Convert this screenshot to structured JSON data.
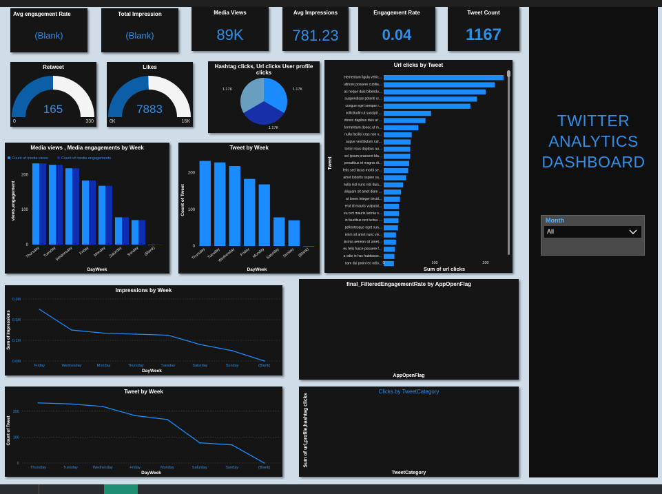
{
  "colors": {
    "accent": "#2f8fe8",
    "bar": "#1a8cff",
    "bar_dark": "#0f2db0",
    "gauge_fill": "#0c5fa6",
    "gauge_rest": "#f4f4f4",
    "card": "#151515",
    "page": "#cfdde9"
  },
  "kpis": [
    {
      "title": "Avg engagement Rate",
      "value": "(Blank)"
    },
    {
      "title": "Total Impression",
      "value": "(Blank)"
    },
    {
      "title": "Media Views",
      "value": "89K"
    },
    {
      "title": "Avg Impressions",
      "value": "781.23"
    },
    {
      "title": "Engagement Rate",
      "value": "0.04"
    },
    {
      "title": "Tweet Count",
      "value": "1167"
    }
  ],
  "gauges": [
    {
      "title": "Retweet",
      "value": "165",
      "min": "0",
      "max": "330",
      "fraction": 0.5
    },
    {
      "title": "Likes",
      "value": "7883",
      "min": "0K",
      "max": "16K",
      "fraction": 0.49
    }
  ],
  "side": {
    "title_lines": [
      "TWITTER",
      "ANALYTICS",
      "DASHBOARD"
    ],
    "slicer_label": "Month",
    "slicer_value": "All"
  },
  "chart_data": [
    {
      "id": "pie",
      "type": "pie",
      "title": "Hashtag clicks, Url clicks User profile clicks",
      "values": [
        1.17,
        1.17,
        1.17
      ],
      "labels": [
        "1.17K",
        "1.17K",
        "1.17K"
      ],
      "colors": [
        "#1a8cff",
        "#1530a8",
        "#6a9ec0"
      ]
    },
    {
      "id": "media",
      "type": "bar",
      "title": "Media views , Media engagements by Week",
      "categories": [
        "Thursday",
        "Tuesday",
        "Wednesday",
        "Friday",
        "Monday",
        "Saturday",
        "Sunday",
        "(Blank)"
      ],
      "series": [
        {
          "name": "Count of media views",
          "values": [
            232,
            228,
            218,
            183,
            168,
            78,
            70,
            0
          ]
        },
        {
          "name": "Count of media engagements",
          "values": [
            232,
            228,
            218,
            183,
            168,
            78,
            70,
            0
          ]
        }
      ],
      "xlabel": "DayWeek",
      "ylabel": "views,engagement",
      "ylim": [
        0,
        250
      ],
      "yticks": [
        0,
        100,
        200
      ]
    },
    {
      "id": "tweetbar",
      "type": "bar",
      "title": "Tweet by Week",
      "categories": [
        "Thursday",
        "Tuesday",
        "Wednesday",
        "Friday",
        "Monday",
        "Saturday",
        "Sunday",
        "(Blank)"
      ],
      "values": [
        232,
        228,
        218,
        183,
        168,
        78,
        70,
        0
      ],
      "xlabel": "DayWeek",
      "ylabel": "Count of Tweet",
      "ylim": [
        0,
        250
      ],
      "yticks": [
        0,
        100,
        200
      ]
    },
    {
      "id": "url",
      "type": "bar",
      "orientation": "horizontal",
      "title": "Url clicks by Tweet",
      "categories": [
        "elementum ligula vehic...",
        "ultrices posuere cubilia...",
        "ac neque duis bibendu...",
        "suspendisse potenti cr...",
        "congue eget semper r...",
        "sollicitudin ut suscipit ...",
        "donec dapibus duis at ...",
        "fermentum donec ut m...",
        "nulla facilisi cras non v...",
        "augue vestibulum rutr...",
        "tortor risus dapibus au...",
        "vel ipsum praesent bla...",
        "penatibus et magnis di...",
        "felis sed lacus morbi se...",
        "amet lobortis sapien sa...",
        "nulla nisl nunc nisl duis...",
        "aliquam sit amet diam ...",
        "at lorem integer tincid...",
        "erat id mauris vulputat...",
        "eu orci mauris lacinia s...",
        "in faucibus orci luctus ...",
        "pellentesque eget nun...",
        "enim sit amet nunc viv...",
        "lacinia aenean sit amet...",
        "eu felis fusce posuere f...",
        "a odio in hac habitasse...",
        "nam dui proin leo odio..."
      ],
      "values": [
        235,
        218,
        200,
        183,
        170,
        93,
        82,
        68,
        55,
        53,
        52,
        52,
        50,
        48,
        44,
        38,
        34,
        32,
        30,
        30,
        29,
        28,
        24,
        24,
        22,
        21,
        20
      ],
      "xlabel": "Sum of url clicks",
      "ylabel": "Tweet",
      "xlim": [
        0,
        250
      ],
      "xticks": [
        0,
        100,
        200
      ]
    },
    {
      "id": "impressions",
      "type": "line",
      "title": "Impressions by Week",
      "categories": [
        "Friday",
        "Wednesday",
        "Monday",
        "Thursday",
        "Tuesday",
        "Saturday",
        "Sunday",
        "(Blank)"
      ],
      "values": [
        0.25,
        0.15,
        0.135,
        0.13,
        0.125,
        0.08,
        0.05,
        0
      ],
      "tick_labels": [
        "0.0M",
        "0.1M",
        "0.2M",
        "0.3M"
      ],
      "yticks": [
        0,
        0.1,
        0.2,
        0.3
      ],
      "xlabel": "DayWeek",
      "ylabel": "Sum of Impressions",
      "ylim": [
        0,
        0.3
      ]
    },
    {
      "id": "tweetline",
      "type": "line",
      "title": "Tweet by Week",
      "categories": [
        "Thursday",
        "Tuesday",
        "Wednesday",
        "Friday",
        "Monday",
        "Saturday",
        "Sunday",
        "(Blank)"
      ],
      "values": [
        232,
        228,
        218,
        183,
        168,
        78,
        70,
        0
      ],
      "yticks": [
        0,
        100,
        200
      ],
      "xlabel": "DayWeek",
      "ylabel": "Count of Tweet",
      "ylim": [
        0,
        250
      ]
    },
    {
      "id": "filtered",
      "type": "bar",
      "title": "final_FilteredEngagementRate by AppOpenFlag",
      "categories": [],
      "values": [],
      "xlabel": "AppOpenFlag",
      "ylabel": ""
    },
    {
      "id": "clicks",
      "type": "bar",
      "title": "Clicks by TweetCategory",
      "categories": [],
      "values": [],
      "xlabel": "TweetCategory",
      "ylabel": "Sum of url,profile,hashtag clicks"
    }
  ]
}
